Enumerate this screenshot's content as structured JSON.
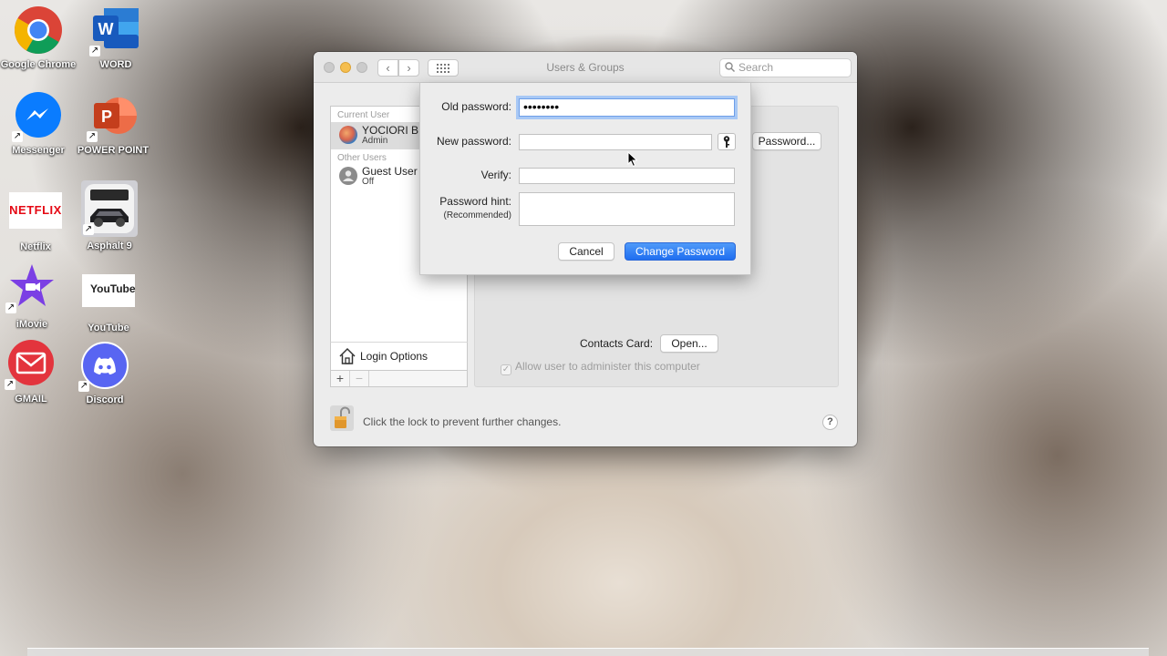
{
  "desktop": {
    "icons": [
      {
        "label": "Google Chrome",
        "icon": "chrome-icon"
      },
      {
        "label": "WORD",
        "icon": "word-icon"
      },
      {
        "label": "Messenger",
        "icon": "messenger-icon"
      },
      {
        "label": "POWER POINT",
        "icon": "powerpoint-icon"
      },
      {
        "label": "Netflix",
        "icon": "netflix-icon",
        "glyph_text": "NETFLIX"
      },
      {
        "label": "Asphalt 9",
        "icon": "asphalt-icon"
      },
      {
        "label": "iMovie",
        "icon": "imovie-icon"
      },
      {
        "label": "YouTube",
        "icon": "youtube-icon",
        "glyph_text": "YouTube"
      },
      {
        "label": "GMAIL",
        "icon": "gmail-icon"
      },
      {
        "label": "Discord",
        "icon": "discord-icon"
      }
    ]
  },
  "window": {
    "title": "Users & Groups",
    "search_placeholder": "Search",
    "users": {
      "current_header": "Current User",
      "current_user": {
        "name": "YOCIORI B I",
        "role": "Admin"
      },
      "other_header": "Other Users",
      "other_users": [
        {
          "name": "Guest User",
          "status": "Off"
        }
      ],
      "login_options": "Login Options",
      "add_symbol": "+",
      "remove_symbol": "−"
    },
    "detail": {
      "change_password_button": "Password...",
      "contacts_card_label": "Contacts Card:",
      "open_button": "Open...",
      "admin_checkbox_label": "Allow user to administer this computer",
      "admin_checked": true
    },
    "lock_text": "Click the lock to prevent further changes.",
    "help_symbol": "?"
  },
  "sheet": {
    "old_password_label": "Old password:",
    "old_password_value": "••••••••",
    "new_password_label": "New password:",
    "new_password_value": "",
    "verify_label": "Verify:",
    "verify_value": "",
    "hint_label": "Password hint:",
    "hint_sublabel": "(Recommended)",
    "hint_value": "",
    "cancel_button": "Cancel",
    "change_button": "Change Password"
  },
  "colors": {
    "accent": "#2f7cf6",
    "close": "#c8c8c8",
    "minimize": "#f5be4f",
    "zoom": "#c8c8c8"
  }
}
